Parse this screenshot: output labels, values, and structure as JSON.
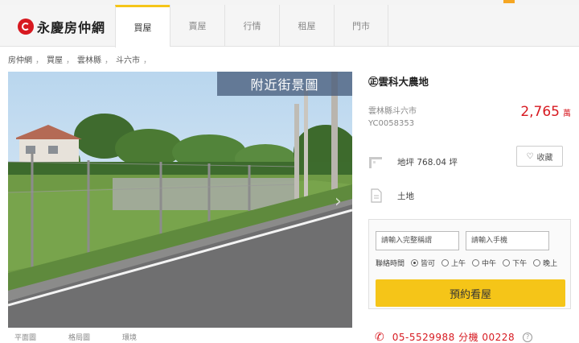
{
  "header": {
    "logo_text": "永慶房仲網",
    "tabs": [
      {
        "label": "買屋",
        "active": true
      },
      {
        "label": "賣屋",
        "active": false
      },
      {
        "label": "行情",
        "active": false
      },
      {
        "label": "租屋",
        "active": false
      },
      {
        "label": "門市",
        "active": false
      }
    ]
  },
  "breadcrumb": [
    "房仲網",
    "買屋",
    "雲林縣",
    "斗六市"
  ],
  "breadcrumb_sep": "，",
  "photo": {
    "badge": "附近街景圖",
    "tabs": [
      "平面圖",
      "格局圖",
      "環境"
    ]
  },
  "listing": {
    "title": "㊣雲科大農地",
    "location": "雲林縣斗六市",
    "code": "YC0058353",
    "price": "2,765",
    "price_unit": "萬",
    "area": "地坪 768.04 坪",
    "type": "土地",
    "favorite_label": "收藏"
  },
  "form": {
    "name_placeholder": "請輸入完整稱謂",
    "phone_placeholder": "請輸入手機",
    "contact_time_label": "聯絡時間",
    "contact_options": [
      {
        "label": "皆可",
        "selected": true
      },
      {
        "label": "上午",
        "selected": false
      },
      {
        "label": "中午",
        "selected": false
      },
      {
        "label": "下午",
        "selected": false
      },
      {
        "label": "晚上",
        "selected": false
      }
    ],
    "book_label": "預約看屋"
  },
  "contact": {
    "phone": "05-5529988 分機 00228"
  },
  "colors": {
    "accent_yellow": "#f5c518",
    "brand_red": "#d71920"
  }
}
